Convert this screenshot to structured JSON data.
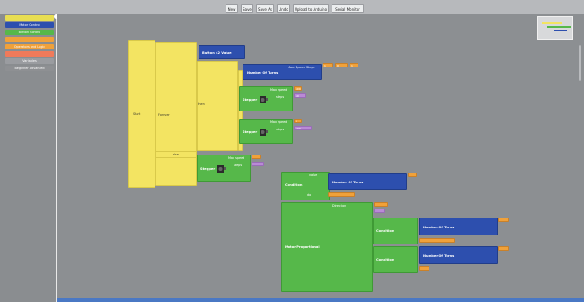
{
  "toolbar": {
    "buttons": [
      "New",
      "Save",
      "Save As",
      "Undo",
      "Upload to Arduino",
      "Serial Monitor"
    ]
  },
  "sidebar": {
    "categories": [
      {
        "label": "",
        "color": "#e8de52"
      },
      {
        "label": "Motor Control",
        "color": "#2d4fae"
      },
      {
        "label": "Button Control",
        "color": "#56b84a"
      },
      {
        "label": "",
        "color": "#f0a13a"
      },
      {
        "label": "Operators and Logic",
        "color": "#f0a13a"
      },
      {
        "label": "",
        "color": "#f07a5a"
      },
      {
        "label": "Variables",
        "color": "#9a9ca0"
      },
      {
        "label": "Beginner Advanced",
        "color": "#8e9093"
      }
    ]
  },
  "blocks": {
    "setup_label": "Start",
    "forever_label": "Forever",
    "if_label": "If",
    "then_label": "then",
    "do_label": "do",
    "button_read": "Button 42 Value",
    "stepper_label": "Stepper",
    "number_of_turns": "Number Of Turns",
    "speed_label": "Max speed",
    "steps_label": "steps",
    "condition": "Condition",
    "motor_block": "Motor Proportional",
    "dir_label": "Direction",
    "else_label": "else",
    "value_label": "value",
    "nudge": "Max. Speed Steps",
    "mv1": "1",
    "mv2": "0",
    "mv3": "1",
    "mv4": "100",
    "mv5": "10",
    "mv6": "1",
    "mv7": "100"
  },
  "colors": {
    "accent": "#4a78c4",
    "yellow": "#f3e462",
    "green": "#56b84a",
    "blue": "#2d4fae"
  }
}
